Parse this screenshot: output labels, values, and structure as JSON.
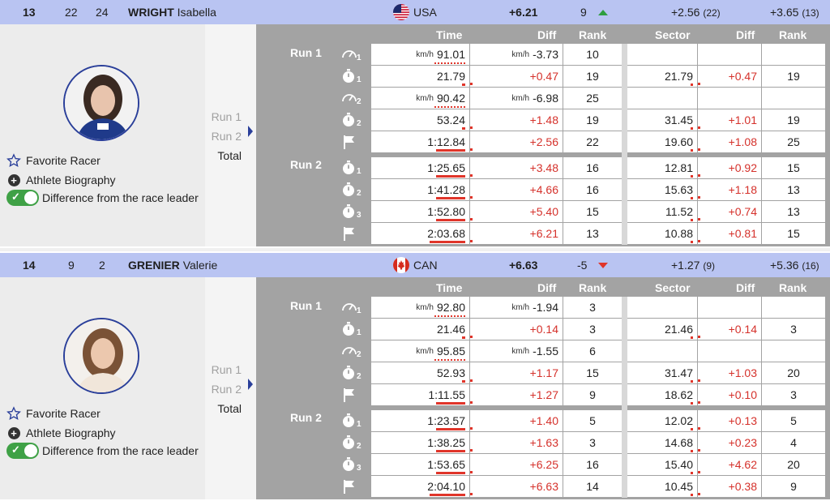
{
  "labels": {
    "col_time": "Time",
    "col_diff": "Diff",
    "col_rank": "Rank",
    "col_sector": "Sector",
    "col_sector_diff": "Diff",
    "col_sector_rank": "Rank",
    "run1": "Run 1",
    "run2": "Run 2",
    "sel_run1": "Run 1",
    "sel_run2": "Run 2",
    "sel_total": "Total",
    "favorite": "Favorite Racer",
    "biography": "Athlete Biography",
    "difference": "Difference from the race leader",
    "unit_kmh": "km/h",
    "sub1": "1",
    "sub2": "2",
    "sub3": "3"
  },
  "colors": {
    "header_bg": "#b9c4f2",
    "grid_bg": "#a3a3a3",
    "negative": "#d5312b",
    "up": "#2e9e3f",
    "down": "#e0352a",
    "toggle": "#3fa146"
  },
  "athletes": [
    {
      "rank": "13",
      "bib": "22",
      "start": "24",
      "last_name": "WRIGHT",
      "first_name": "Isabella",
      "country": "USA",
      "flag_icon": "usa-flag-icon",
      "gap": "+6.21",
      "movement": "9",
      "movement_dir": "up",
      "gap2": "+2.56",
      "gap2_rank": "(22)",
      "gap3": "+3.65",
      "gap3_rank": "(13)",
      "toggle_on": true,
      "rows": [
        {
          "time": "91.01",
          "diff": "-3.73",
          "rank": "10",
          "sector": "",
          "sdiff": "",
          "srank": "",
          "speed": true
        },
        {
          "time": "21.79",
          "diff": "+0.47",
          "rank": "19",
          "sector": "21.79",
          "sdiff": "+0.47",
          "srank": "19"
        },
        {
          "time": "90.42",
          "diff": "-6.98",
          "rank": "25",
          "sector": "",
          "sdiff": "",
          "srank": "",
          "speed": true
        },
        {
          "time": "53.24",
          "diff": "+1.48",
          "rank": "19",
          "sector": "31.45",
          "sdiff": "+1.01",
          "srank": "19"
        },
        {
          "time": "1:12.84",
          "diff": "+2.56",
          "rank": "22",
          "sector": "19.60",
          "sdiff": "+1.08",
          "srank": "25"
        },
        {
          "time": "1:25.65",
          "diff": "+3.48",
          "rank": "16",
          "sector": "12.81",
          "sdiff": "+0.92",
          "srank": "15"
        },
        {
          "time": "1:41.28",
          "diff": "+4.66",
          "rank": "16",
          "sector": "15.63",
          "sdiff": "+1.18",
          "srank": "13"
        },
        {
          "time": "1:52.80",
          "diff": "+5.40",
          "rank": "15",
          "sector": "11.52",
          "sdiff": "+0.74",
          "srank": "13"
        },
        {
          "time": "2:03.68",
          "diff": "+6.21",
          "rank": "13",
          "sector": "10.88",
          "sdiff": "+0.81",
          "srank": "15"
        }
      ]
    },
    {
      "rank": "14",
      "bib": "9",
      "start": "2",
      "last_name": "GRENIER",
      "first_name": "Valerie",
      "country": "CAN",
      "flag_icon": "canada-flag-icon",
      "gap": "+6.63",
      "movement": "-5",
      "movement_dir": "down",
      "gap2": "+1.27",
      "gap2_rank": "(9)",
      "gap3": "+5.36",
      "gap3_rank": "(16)",
      "toggle_on": true,
      "rows": [
        {
          "time": "92.80",
          "diff": "-1.94",
          "rank": "3",
          "sector": "",
          "sdiff": "",
          "srank": "",
          "speed": true
        },
        {
          "time": "21.46",
          "diff": "+0.14",
          "rank": "3",
          "sector": "21.46",
          "sdiff": "+0.14",
          "srank": "3"
        },
        {
          "time": "95.85",
          "diff": "-1.55",
          "rank": "6",
          "sector": "",
          "sdiff": "",
          "srank": "",
          "speed": true
        },
        {
          "time": "52.93",
          "diff": "+1.17",
          "rank": "15",
          "sector": "31.47",
          "sdiff": "+1.03",
          "srank": "20"
        },
        {
          "time": "1:11.55",
          "diff": "+1.27",
          "rank": "9",
          "sector": "18.62",
          "sdiff": "+0.10",
          "srank": "3"
        },
        {
          "time": "1:23.57",
          "diff": "+1.40",
          "rank": "5",
          "sector": "12.02",
          "sdiff": "+0.13",
          "srank": "5"
        },
        {
          "time": "1:38.25",
          "diff": "+1.63",
          "rank": "3",
          "sector": "14.68",
          "sdiff": "+0.23",
          "srank": "4"
        },
        {
          "time": "1:53.65",
          "diff": "+6.25",
          "rank": "16",
          "sector": "15.40",
          "sdiff": "+4.62",
          "srank": "20"
        },
        {
          "time": "2:04.10",
          "diff": "+6.63",
          "rank": "14",
          "sector": "10.45",
          "sdiff": "+0.38",
          "srank": "9"
        }
      ]
    }
  ]
}
